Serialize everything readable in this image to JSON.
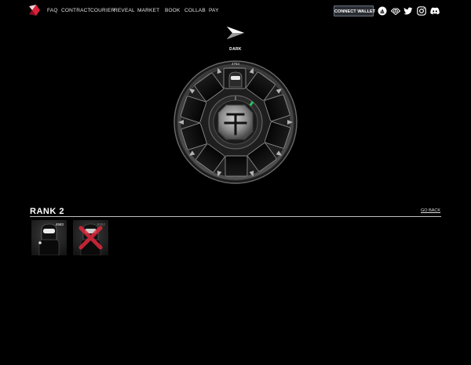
{
  "nav": {
    "links": [
      "FAQ",
      "CONTRACT",
      "COURIER",
      "REVEAL",
      "MARKET",
      "BOOK",
      "COLLAB",
      "PAY"
    ],
    "connect_label": "CONNECT WALLET"
  },
  "selector": {
    "label": "DARK"
  },
  "wheel": {
    "token_id": "4754"
  },
  "rank": {
    "title": "RANK 2",
    "go_back": "GO BACK",
    "cards": [
      {
        "id": "4583",
        "state": "available"
      },
      {
        "id": "5052",
        "state": "crossed-out"
      }
    ]
  },
  "colors": {
    "background": "#000000",
    "accent_red": "#e0283c",
    "button_bg": "#2a2d33"
  },
  "icons": [
    "logo-icon",
    "opensea-icon",
    "looksrare-icon",
    "twitter-icon",
    "instagram-icon",
    "discord-icon",
    "dark-emblem-icon",
    "x-mark-icon"
  ]
}
